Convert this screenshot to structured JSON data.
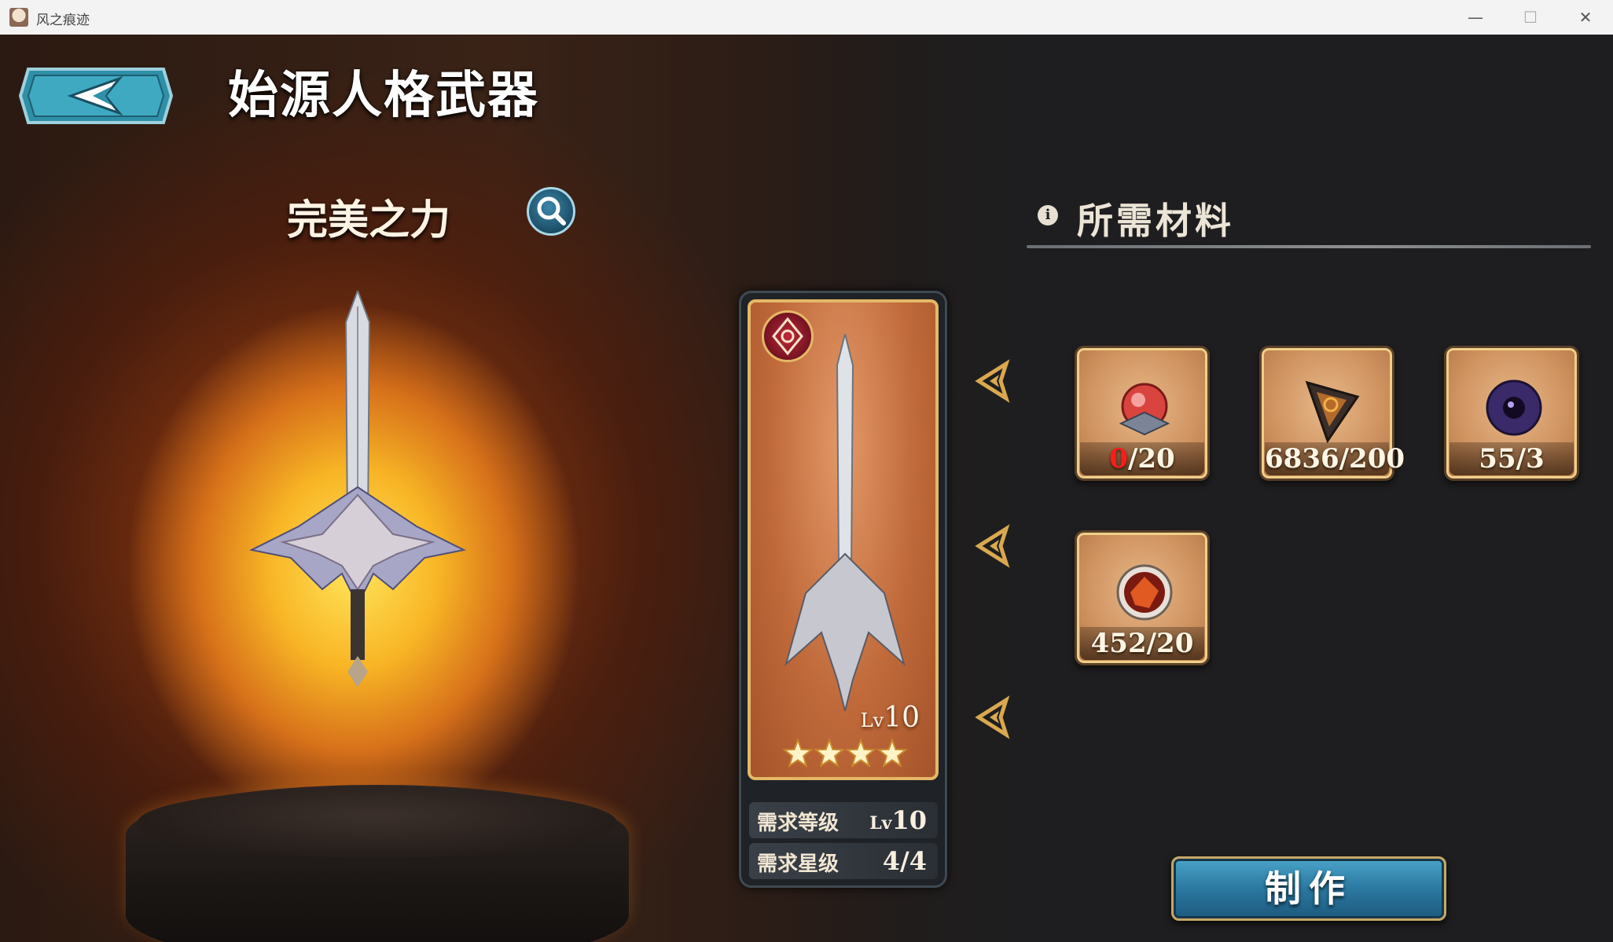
{
  "window": {
    "title": "风之痕迹",
    "minimize": "—",
    "maximize": "☐",
    "close": "✕"
  },
  "header": {
    "title": "始源人格武器"
  },
  "weapon": {
    "name": "完美之力",
    "level_prefix": "Lv",
    "level_value": "10",
    "stars": 4,
    "requirements": {
      "level_label": "需求等级",
      "level_prefix": "Lv",
      "level_value": "10",
      "star_label": "需求星级",
      "star_value": "4/4"
    }
  },
  "materials": {
    "title": "所需材料",
    "info_icon": "i",
    "items": [
      {
        "icon": "red-crystal-icon",
        "have": "0",
        "need": "/20",
        "insufficient": true
      },
      {
        "icon": "rune-triangle-icon",
        "count": "6836/200"
      },
      {
        "icon": "void-orb-icon",
        "count": "55/3"
      },
      {
        "icon": "lava-orb-icon",
        "count": "452/20"
      }
    ]
  },
  "actions": {
    "craft_label": "制作"
  },
  "colors": {
    "accent": "#2b78a0",
    "gold": "#e4b866",
    "insufficient": "#ff1b1b"
  }
}
